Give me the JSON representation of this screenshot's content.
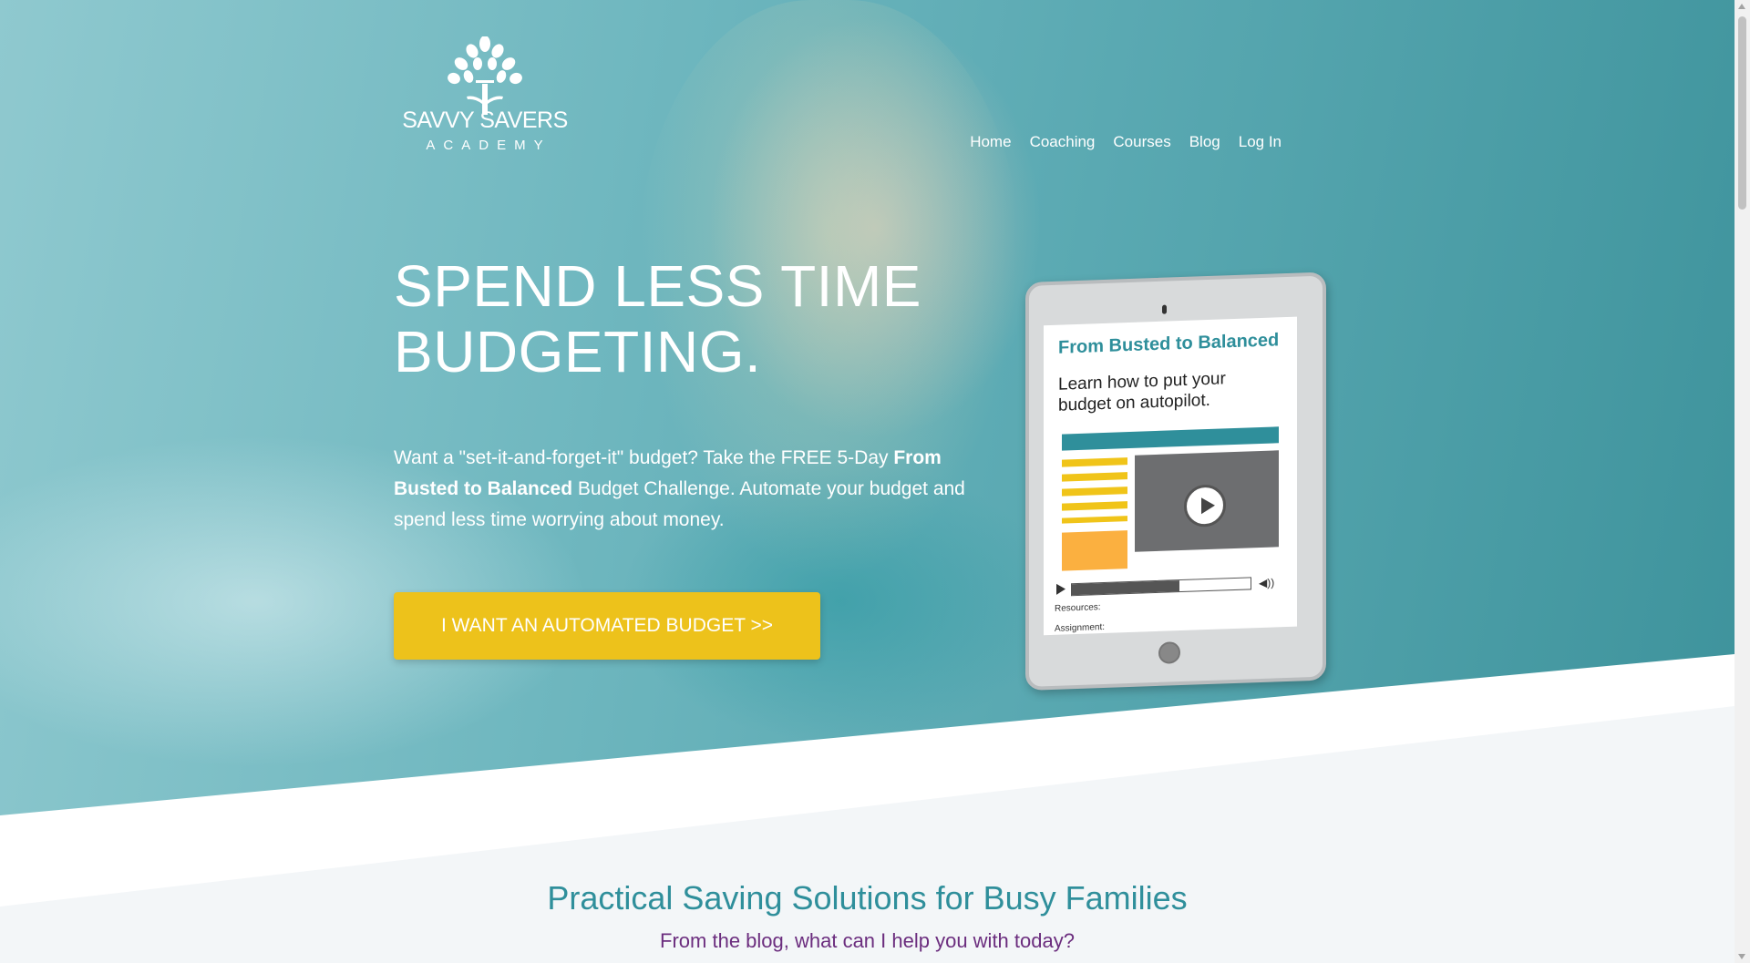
{
  "logo": {
    "name": "SAVVY SAVERS",
    "sub": "ACADEMY"
  },
  "nav": [
    {
      "label": "Home"
    },
    {
      "label": "Coaching"
    },
    {
      "label": "Courses"
    },
    {
      "label": "Blog"
    },
    {
      "label": "Log In"
    }
  ],
  "hero": {
    "title": "SPEND LESS TIME BUDGETING.",
    "text_before": "Want a \"set-it-and-forget-it\" budget? Take the FREE 5-Day ",
    "text_bold": "From Busted to Balanced",
    "text_after": " Budget Challenge. Automate your budget and spend less time worrying about money.",
    "cta": "I WANT AN AUTOMATED BUDGET >>"
  },
  "tablet": {
    "title": "From Busted to Balanced",
    "subtitle": "Learn how to put your budget on autopilot.",
    "resources_label": "Resources:",
    "assignment_label": "Assignment:",
    "video_progress": 0.6
  },
  "section": {
    "title": "Practical Saving Solutions for Busy Families",
    "subtitle": "From the blog, what can I help you with today?"
  },
  "colors": {
    "teal": "#2f8f9b",
    "cta": "#edc21b",
    "purple": "#6b2d7e"
  }
}
